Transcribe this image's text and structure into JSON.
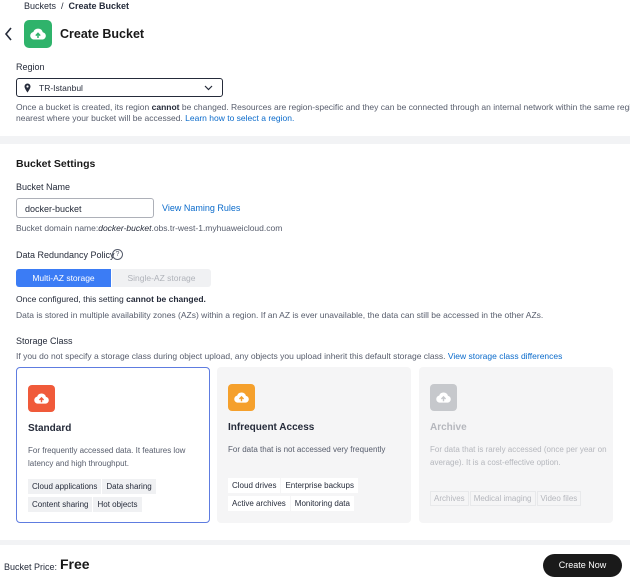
{
  "breadcrumb": {
    "parent": "Buckets",
    "separator": "/",
    "current": "Create Bucket"
  },
  "header": {
    "title": "Create Bucket",
    "icon": "cloud-upload-icon",
    "icon_color": "#2fb36b"
  },
  "region": {
    "label": "Region",
    "value": "TR-Istanbul",
    "note_part1": "Once a bucket is created, its region ",
    "note_bold": "cannot",
    "note_part2": " be changed. Resources are region-specific and they can be connected through an internal network within the same region.",
    "note_line2": "nearest where your bucket will be accessed. ",
    "note_link": "Learn how to select a region."
  },
  "settings": {
    "title": "Bucket Settings",
    "name_label": "Bucket Name",
    "name_value": "docker-bucket",
    "naming_rules_link": "View Naming Rules",
    "domain_prefix": "Bucket domain name:",
    "domain_bucket": "docker-bucket",
    "domain_suffix": ".obs.tr-west-1.myhuaweicloud.com",
    "redundancy_label": "Data Redundancy Policy",
    "redundancy_help": "?",
    "redundancy_options": [
      "Multi-AZ storage",
      "Single-AZ storage"
    ],
    "redundancy_note_part1": "Once configured, this setting ",
    "redundancy_note_bold": "cannot be changed.",
    "redundancy_desc": "Data is stored in multiple availability zones (AZs) within a region. If an AZ is ever unavailable, the data can still be accessed in the other AZs.",
    "storage_class_label": "Storage Class",
    "storage_class_note": "If you do not specify a storage class during object upload, any objects you upload inherit this default storage class. ",
    "storage_class_link": "View storage class differences"
  },
  "storage_classes": [
    {
      "title": "Standard",
      "desc": "For frequently accessed data. It features low latency and high throughput.",
      "tags": [
        "Cloud applications",
        "Data sharing",
        "Content sharing",
        "Hot objects"
      ],
      "icon_color": "#f05a3a",
      "selected": true
    },
    {
      "title": "Infrequent Access",
      "desc": "For data that is not accessed very frequently",
      "tags": [
        "Cloud drives",
        "Enterprise backups",
        "Active archives",
        "Monitoring data"
      ],
      "icon_color": "#f5a02c",
      "selected": false
    },
    {
      "title": "Archive",
      "desc": "For data that is rarely accessed (once per year on average). It is a cost-effective option.",
      "tags": [
        "Archives",
        "Medical imaging",
        "Video files"
      ],
      "icon_color": "#c6c8cc",
      "selected": false
    }
  ],
  "footer": {
    "price_label": "Bucket Price:",
    "price_value": "Free",
    "create_button": "Create Now"
  },
  "colors": {
    "primary": "#3b7cf5",
    "link": "#0b6bcb",
    "selected_border": "#5e7ce0",
    "button": "#1a1a1a"
  }
}
